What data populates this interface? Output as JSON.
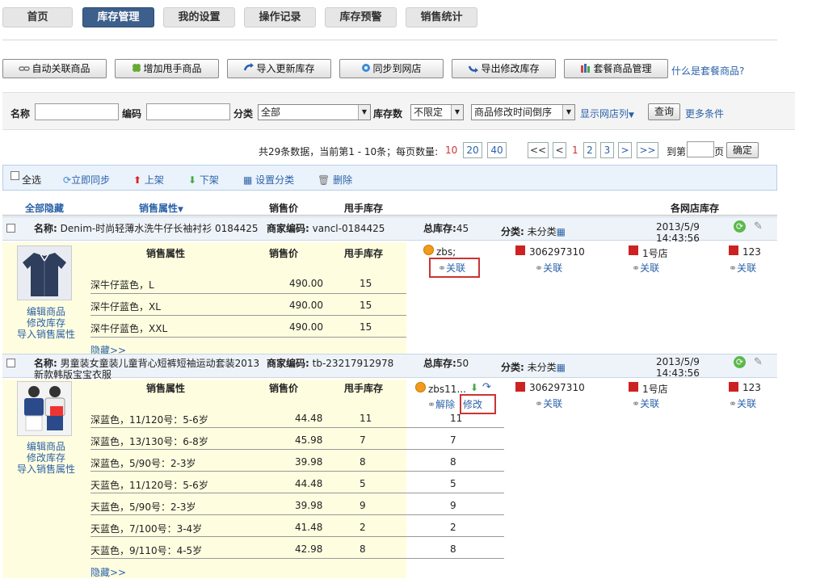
{
  "nav": {
    "tabs": [
      "首页",
      "库存管理",
      "我的设置",
      "操作记录",
      "库存预警",
      "销售统计"
    ],
    "active": 1
  },
  "toolbar": {
    "buttons": [
      "自动关联商品",
      "增加甩手商品",
      "导入更新库存",
      "同步到网店",
      "导出修改库存",
      "套餐商品管理"
    ],
    "help_link": "什么是套餐商品?"
  },
  "search": {
    "name_label": "名称",
    "code_label": "编码",
    "category_label": "分类",
    "category_value": "全部",
    "stock_label": "库存数",
    "stock_value": "不限定",
    "sort_value": "商品修改时间倒序",
    "show_columns": "显示网店列",
    "query_button": "查询",
    "more_link": "更多条件"
  },
  "pagination": {
    "info": "共29条数据，当前第1 - 10条；每页数量:",
    "sizes": [
      "10",
      "20",
      "40"
    ],
    "nav": [
      "<<",
      "<",
      "1",
      "2",
      "3",
      ">",
      ">>"
    ],
    "goto_label": "到第",
    "page_suffix": "页",
    "confirm": "确定"
  },
  "actions": {
    "select_all": "全选",
    "items": [
      "立即同步",
      "上架",
      "下架",
      "设置分类",
      "删除"
    ]
  },
  "table_header": {
    "hide_all": "全部隐藏",
    "sales_attr": "销售属性",
    "price": "销售价",
    "stock": "甩手库存",
    "shop_stock": "各网店库存"
  },
  "products": [
    {
      "name_label": "名称:",
      "name": "Denim-时尚轻薄水洗牛仔长袖衬衫 0184425",
      "code_label": "商家编码:",
      "code": "vancl-0184425",
      "total_label": "总库存:",
      "total": "45",
      "category_label": "分类:",
      "category": "未分类",
      "date": "2013/5/9",
      "time": "14:43:56",
      "links": [
        "编辑商品",
        "修改库存",
        "导入销售属性"
      ],
      "sub_header": {
        "attr": "销售属性",
        "price": "销售价",
        "stock": "甩手库存"
      },
      "rows": [
        {
          "attr": "深牛仔蓝色，L",
          "price": "490.00",
          "stock": "15"
        },
        {
          "attr": "深牛仔蓝色，XL",
          "price": "490.00",
          "stock": "15"
        },
        {
          "attr": "深牛仔蓝色，XXL",
          "price": "490.00",
          "stock": "15"
        }
      ],
      "shops": [
        {
          "name": "zbs;",
          "link": "关联"
        },
        {
          "name": "306297310",
          "link": "关联"
        },
        {
          "name": "1号店",
          "link": "关联"
        },
        {
          "name": "123",
          "link": "关联"
        }
      ],
      "hide_link": "隐藏>>"
    },
    {
      "name_label": "名称:",
      "name": "男童装女童装儿童背心短裤短袖运动套装2013",
      "name_line2": "新款韩版宝宝衣服",
      "code_label": "商家编码:",
      "code": "tb-23217912978",
      "total_label": "总库存:",
      "total": "50",
      "category_label": "分类:",
      "category": "未分类",
      "date": "2013/5/9",
      "time": "14:43:56",
      "links": [
        "编辑商品",
        "修改库存",
        "导入销售属性"
      ],
      "sub_header": {
        "attr": "销售属性",
        "price": "销售价",
        "stock": "甩手库存"
      },
      "rows": [
        {
          "attr": "深蓝色，11/120号：5-6岁",
          "price": "44.48",
          "stock": "11",
          "shop": "11"
        },
        {
          "attr": "深蓝色，13/130号：6-8岁",
          "price": "45.98",
          "stock": "7",
          "shop": "7"
        },
        {
          "attr": "深蓝色，5/90号：2-3岁",
          "price": "39.98",
          "stock": "8",
          "shop": "8"
        },
        {
          "attr": "天蓝色，11/120号：5-6岁",
          "price": "44.48",
          "stock": "5",
          "shop": "5"
        },
        {
          "attr": "天蓝色，5/90号：2-3岁",
          "price": "39.98",
          "stock": "9",
          "shop": "9"
        },
        {
          "attr": "天蓝色，7/100号：3-4岁",
          "price": "41.48",
          "stock": "2",
          "shop": "2"
        },
        {
          "attr": "天蓝色，9/110号：4-5岁",
          "price": "42.98",
          "stock": "8",
          "shop": "8"
        }
      ],
      "shops": [
        {
          "name": "zbs11...",
          "unlink": "解除",
          "edit": "修改"
        },
        {
          "name": "306297310",
          "link": "关联"
        },
        {
          "name": "1号店",
          "link": "关联"
        },
        {
          "name": "123",
          "link": "关联"
        }
      ],
      "hide_link": "隐藏>>"
    }
  ],
  "colors": {
    "nav_active": "#3d5f8c",
    "link": "#2b62a8",
    "highlight": "#c33",
    "yellow": "#fffde0"
  }
}
